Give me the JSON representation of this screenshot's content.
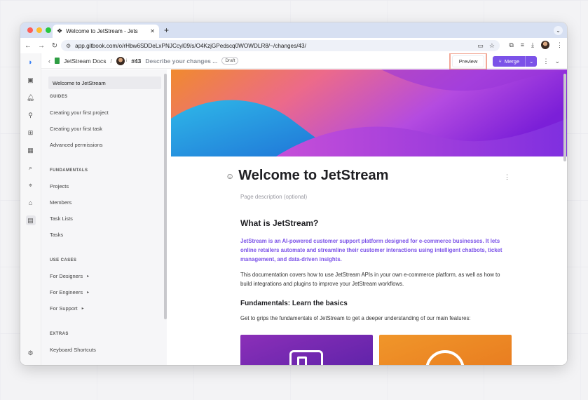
{
  "browser": {
    "tab_title": "Welcome to JetStream - Jets",
    "url": "app.gitbook.com/o/rHbw6SDDeLxPNJCcyl09/s/O4KzjGPedscq0WOWDLR8/~/changes/43/"
  },
  "topbar": {
    "space_name": "JetStream Docs",
    "separator": "/",
    "user_initial": "i",
    "change_request_number": "#43",
    "change_request_subject": "Describe your changes ...",
    "draft_label": "Draft",
    "preview_label": "Preview",
    "merge_label": "Merge"
  },
  "sidebar": {
    "active_item": "Welcome to JetStream",
    "groups": [
      {
        "heading": "GUIDES",
        "items": [
          "Creating your first project",
          "Creating your first task",
          "Advanced permissions"
        ]
      },
      {
        "heading": "FUNDAMENTALS",
        "items": [
          "Projects",
          "Members",
          "Task Lists",
          "Tasks"
        ]
      },
      {
        "heading": "USE CASES",
        "items": [
          "For Designers",
          "For Engineers",
          "For Support"
        ]
      },
      {
        "heading": "EXTRAS",
        "items": [
          "Keyboard Shortcuts"
        ]
      }
    ]
  },
  "page": {
    "title": "Welcome to JetStream",
    "description_placeholder": "Page description (optional)",
    "section1_heading": "What is JetStream?",
    "intro": "JetStream is an AI-powered customer support platform designed for e-commerce businesses. It lets online retailers automate and streamline their customer interactions using intelligent chatbots, ticket management, and data-driven insights.",
    "paragraph": "This documentation covers how to use JetStream APIs in your own e-commerce platform, as well as how to build integrations and plugins to improve your JetStream workflows.",
    "section2_heading": "Fundamentals: Learn the basics",
    "section2_text": "Get to grips the fundamentals of JetStream to get a deeper understanding of our main features:"
  },
  "colors": {
    "accent": "#7b52e8",
    "highlight": "#f2a897"
  }
}
